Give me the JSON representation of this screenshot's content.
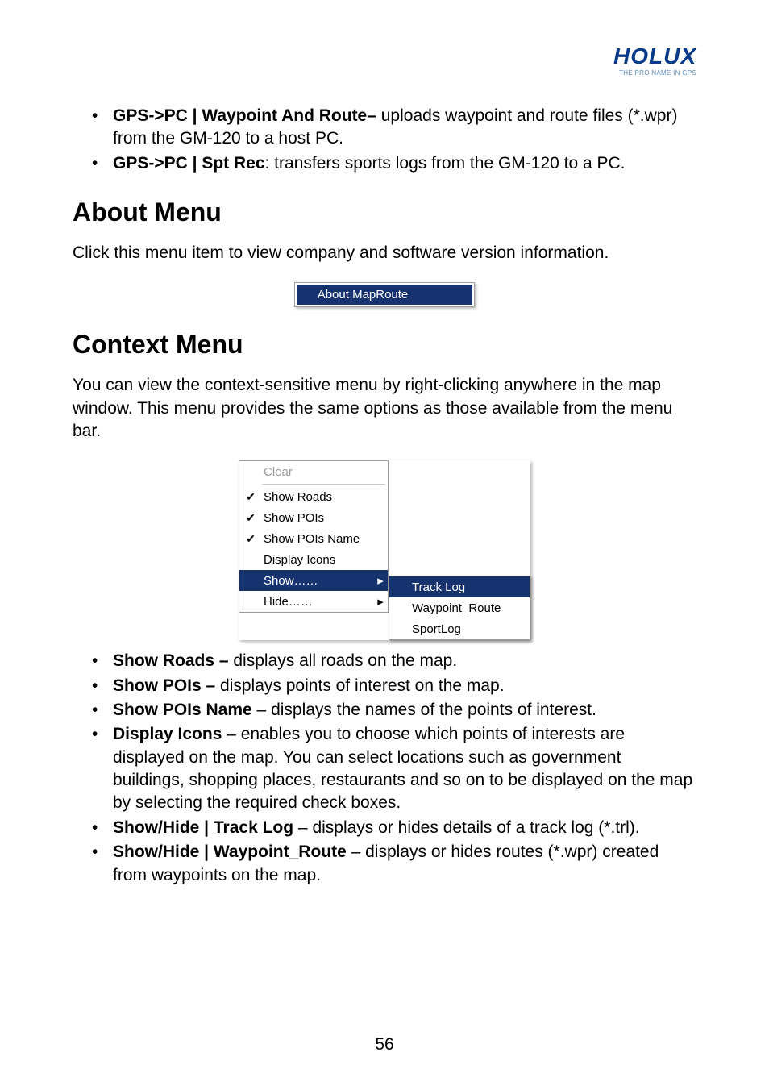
{
  "logo": {
    "brand": "HOLUX",
    "tagline": "THE PRO NAME IN GPS"
  },
  "top_list": [
    {
      "strong": "GPS->PC | Waypoint And Route–",
      "rest": " uploads waypoint and route files (*.wpr) from the GM-120 to a host PC."
    },
    {
      "strong": "GPS->PC | Spt Rec",
      "rest": ": transfers sports logs from the GM-120 to a PC."
    }
  ],
  "section1": {
    "title": "About Menu",
    "para": "Click this menu item to view company and software version information.",
    "menu_item": "About MapRoute"
  },
  "section2": {
    "title": "Context Menu",
    "para": "You can view the context-sensitive menu by right-clicking anywhere in the map window. This menu provides the same options as those available from the menu bar.",
    "menu": {
      "items": [
        {
          "label": "Clear",
          "checked": false,
          "disabled": true,
          "arrow": false
        },
        {
          "sep": true
        },
        {
          "label": "Show Roads",
          "checked": true,
          "disabled": false,
          "arrow": false
        },
        {
          "label": "Show POIs",
          "checked": true,
          "disabled": false,
          "arrow": false
        },
        {
          "label": "Show POIs Name",
          "checked": true,
          "disabled": false,
          "arrow": false
        },
        {
          "label": "Display Icons",
          "checked": false,
          "disabled": false,
          "arrow": false
        },
        {
          "label": "Show……",
          "checked": false,
          "disabled": false,
          "arrow": true,
          "highlight": true
        },
        {
          "label": "Hide……",
          "checked": false,
          "disabled": false,
          "arrow": true
        }
      ],
      "submenu": [
        {
          "label": "Track Log",
          "highlight": true
        },
        {
          "label": "Waypoint_Route"
        },
        {
          "label": "SportLog"
        }
      ]
    },
    "bullets": [
      {
        "strong": "Show Roads –",
        "rest": " displays all roads on the map."
      },
      {
        "strong": "Show POIs –",
        "rest": " displays points of interest on the map."
      },
      {
        "strong": "Show POIs Name",
        "rest": " – displays the names of the points of interest."
      },
      {
        "strong": "Display Icons",
        "rest": " – enables you to choose which points of interests are displayed on the map. You can select locations such as government buildings, shopping places, restaurants and so on to be displayed on the map by selecting the required check boxes."
      },
      {
        "strong": "Show/Hide | Track Log",
        "rest": " – displays or hides details of a track log (*.trl)."
      },
      {
        "strong": "Show/Hide | Waypoint_Route",
        "rest": " – displays or hides routes (*.wpr) created from waypoints on the map."
      }
    ]
  },
  "page_number": "56"
}
